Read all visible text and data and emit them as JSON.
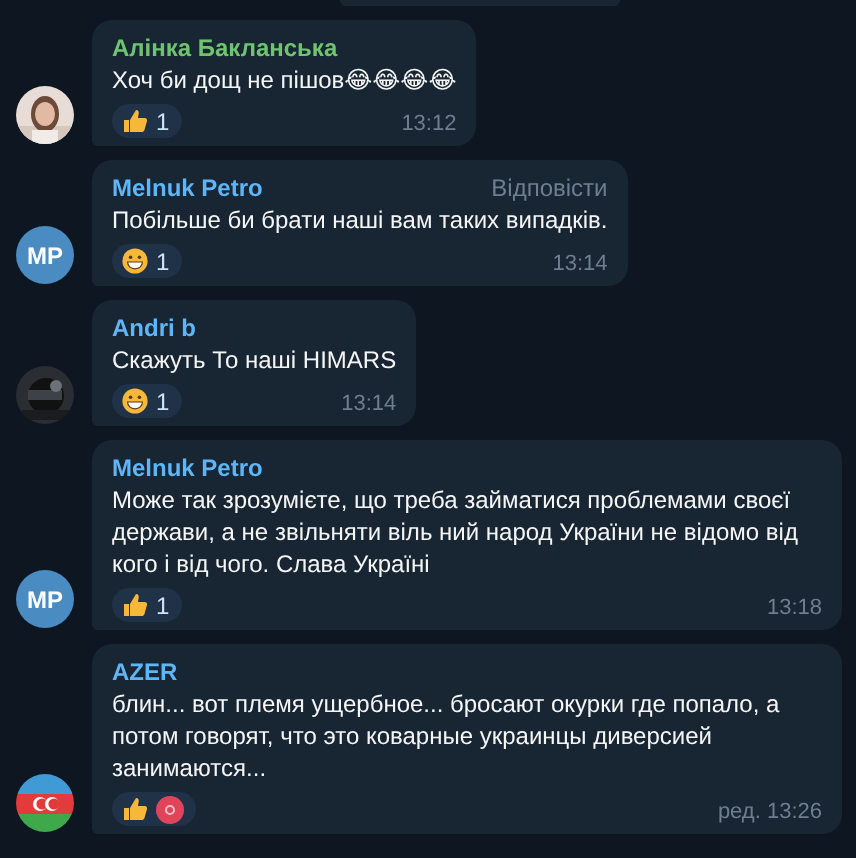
{
  "messages": [
    {
      "author": "Алінка Бакланська",
      "color": "#6fc56f",
      "text": "Хоч би дощ не пішов😂😂😂😂",
      "reactions": [
        {
          "kind": "thumbs",
          "count": "1"
        }
      ],
      "time": "13:12"
    },
    {
      "author": "Melnuk Petro",
      "color": "#5eb5f7",
      "avatar": {
        "kind": "initials",
        "initials": "MP",
        "color": "#4a8bc2"
      },
      "reply_label": "Відповісти",
      "text": "Побільше би брати наші вам таких випадків.",
      "reactions": [
        {
          "kind": "grin",
          "count": "1"
        }
      ],
      "time": "13:14"
    },
    {
      "author": "Andri b",
      "color": "#5eb5f7",
      "text": "Скажуть То наші HIMARS",
      "reactions": [
        {
          "kind": "grin",
          "count": "1"
        }
      ],
      "time": "13:14"
    },
    {
      "author": "Melnuk Petro",
      "color": "#5eb5f7",
      "avatar": {
        "kind": "initials",
        "initials": "MP",
        "color": "#4a8bc2"
      },
      "text": "Може так зрозумієте, що треба займатися проблемами своєї держави, а не звільняти віль ний народ України не відомо від кого і від чого. Слава Україні",
      "reactions": [
        {
          "kind": "thumbs",
          "count": "1"
        }
      ],
      "time": "13:18"
    },
    {
      "author": "AZER",
      "color": "#5eb5f7",
      "avatar": {
        "kind": "flag"
      },
      "text": "блин... вот племя ущербное... бросают окурки где попало, а потом говорят, что это коварные украинцы диверсией занимаются...",
      "reactions": [
        {
          "kind": "thumbs",
          "color": "#e0445a"
        }
      ],
      "time": "ред. 13:26"
    }
  ]
}
